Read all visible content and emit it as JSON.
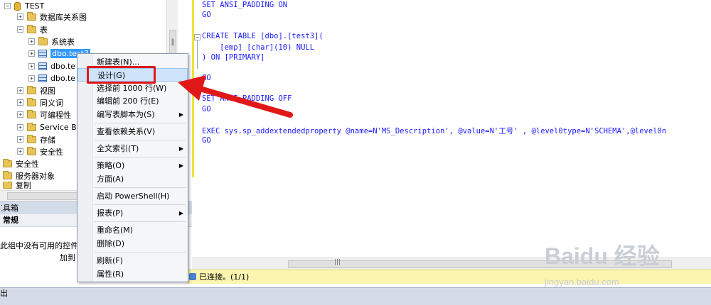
{
  "explorer": {
    "db_name": "TEST",
    "items": [
      {
        "label": "数据库关系图"
      },
      {
        "label": "表"
      },
      {
        "label": "系统表"
      },
      {
        "label": "dbo.test3"
      },
      {
        "label": "dbo.te"
      },
      {
        "label": "dbo.te"
      },
      {
        "label": "视图"
      },
      {
        "label": "同义词"
      },
      {
        "label": "可编程性"
      },
      {
        "label": "Service Br"
      },
      {
        "label": "存储"
      },
      {
        "label": "安全性"
      },
      {
        "label": "安全性"
      },
      {
        "label": "服务器对象"
      },
      {
        "label": "复制"
      }
    ]
  },
  "toolbox": {
    "header": "工具箱",
    "group": "常规",
    "empty_text": "此组中没有可用的控件。",
    "add_text": "加到"
  },
  "output": {
    "title": "出"
  },
  "editor": {
    "lines": [
      {
        "text": "SET ANSI_PADDING ON"
      },
      {
        "text": "GO"
      },
      {
        "text": "CREATE TABLE [dbo].[test3]("
      },
      {
        "text": "    [emp] [char](10) NULL"
      },
      {
        "text": ") ON [PRIMARY]"
      },
      {
        "text": "GO"
      },
      {
        "text": "SET ANSI_PADDING OFF"
      },
      {
        "text": "GO"
      },
      {
        "text": "EXEC sys.sp_addextendedproperty @name=N'MS_Description', @value=N'工号' , @level0type=N'SCHEMA',@level0n"
      },
      {
        "text": "GO"
      }
    ]
  },
  "status": {
    "text": "已连接。(1/1)"
  },
  "context_menu": {
    "items": [
      {
        "label": "新建表(N)..."
      },
      {
        "label": "设计(G)"
      },
      {
        "label": "选择前 1000 行(W)"
      },
      {
        "label": "编辑前 200 行(E)"
      },
      {
        "label": "编写表脚本为(S)"
      },
      {
        "label": "查看依赖关系(V)"
      },
      {
        "label": "全文索引(T)"
      },
      {
        "label": "策略(O)"
      },
      {
        "label": "方面(A)"
      },
      {
        "label": "启动 PowerShell(H)"
      },
      {
        "label": "报表(P)"
      },
      {
        "label": "重命名(M)"
      },
      {
        "label": "删除(D)"
      },
      {
        "label": "刷新(F)"
      },
      {
        "label": "属性(R)"
      }
    ]
  },
  "watermark": {
    "brand": "Baidu 经验",
    "url": "jingyan.baidu.com"
  },
  "colors": {
    "highlight": "#cfe4fb",
    "annotation_red": "#e01818",
    "status_yellow": "#fbf5b0"
  }
}
